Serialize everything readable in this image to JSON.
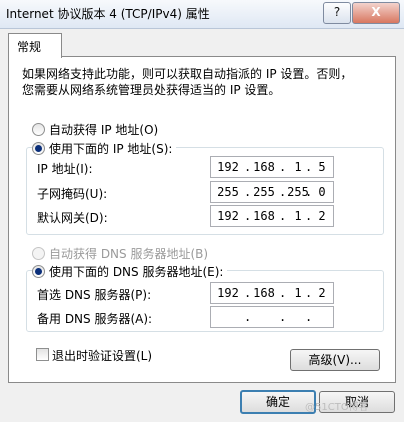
{
  "window": {
    "title": "Internet 协议版本 4 (TCP/IPv4) 属性",
    "help_button": "?",
    "close_button": "X"
  },
  "tabs": [
    {
      "label": "常规",
      "active": true
    }
  ],
  "description": "如果网络支持此功能，则可以获取自动指派的 IP 设置。否则，\n您需要从网络系统管理员处获得适当的 IP 设置。",
  "ip_section": {
    "auto_option": "自动获得 IP 地址(O)",
    "manual_option": "使用下面的 IP 地址(S):",
    "selected": "manual",
    "fields": [
      {
        "label": "IP 地址(I):",
        "octets": [
          "192",
          "168",
          "1",
          "5"
        ]
      },
      {
        "label": "子网掩码(U):",
        "octets": [
          "255",
          "255",
          "255",
          "0"
        ]
      },
      {
        "label": "默认网关(D):",
        "octets": [
          "192",
          "168",
          "1",
          "2"
        ]
      }
    ]
  },
  "dns_section": {
    "auto_option": "自动获得 DNS 服务器地址(B)",
    "manual_option": "使用下面的 DNS 服务器地址(E):",
    "selected": "manual",
    "fields": [
      {
        "label": "首选 DNS 服务器(P):",
        "octets": [
          "192",
          "168",
          "1",
          "2"
        ]
      },
      {
        "label": "备用 DNS 服务器(A):",
        "octets": [
          "",
          "",
          "",
          ""
        ]
      }
    ]
  },
  "validate_checkbox": {
    "label": "退出时验证设置(L)",
    "checked": false
  },
  "advanced_button": "高级(V)...",
  "ok_button": "确定",
  "cancel_button": "取消",
  "watermark": "@51CTO博客"
}
